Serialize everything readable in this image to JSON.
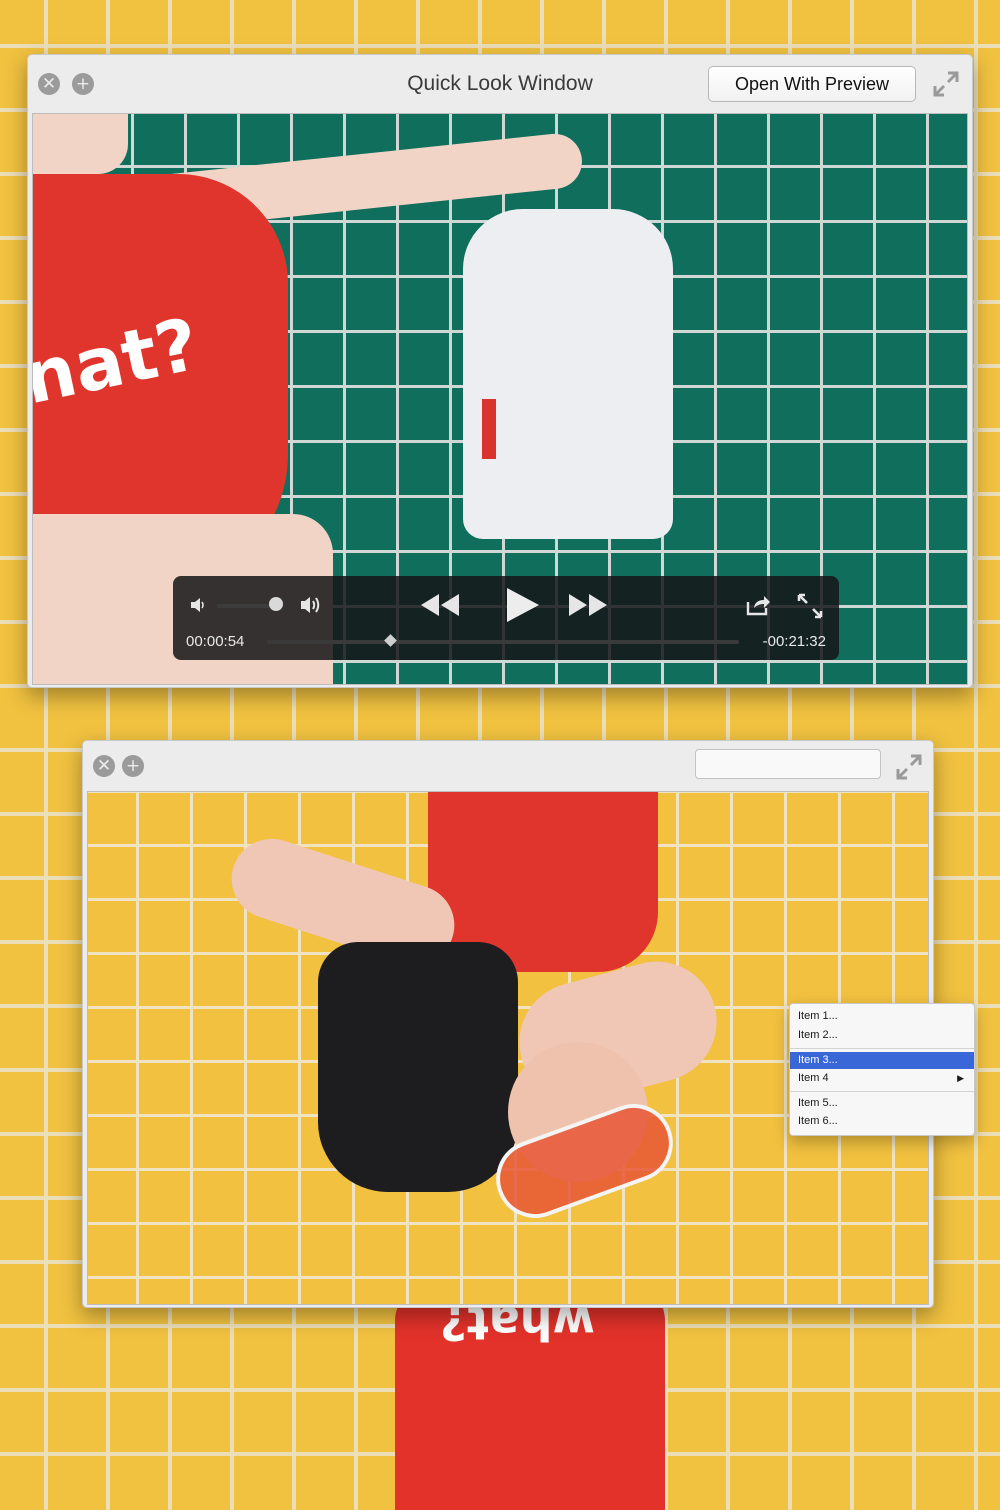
{
  "window1": {
    "title": "Quick Look Window",
    "open_with_label": "Open With Preview",
    "close_glyph": "✕",
    "add_glyph": "+",
    "photo_text": "nat?",
    "player": {
      "elapsed": "00:00:54",
      "remaining": "-00:21:32",
      "volume_level": 0.9,
      "progress": 0.26
    }
  },
  "window2": {
    "close_glyph": "✕",
    "add_glyph": "+",
    "search_value": ""
  },
  "background": {
    "figure_text": "what?"
  },
  "context_menu": {
    "items": [
      {
        "label": "Item 1..."
      },
      {
        "label": "Item 2..."
      },
      {
        "label": "Item 3..."
      },
      {
        "label": "Item 4"
      },
      {
        "label": "Item 5..."
      },
      {
        "label": "Item 6..."
      }
    ],
    "selected_index": 2,
    "submenu_arrow": "▶"
  },
  "colors": {
    "wall_yellow": "#f1c240",
    "tile_green": "#0f6e5c",
    "swimsuit_red": "#e0352d",
    "menu_highlight": "#3a67d8"
  }
}
